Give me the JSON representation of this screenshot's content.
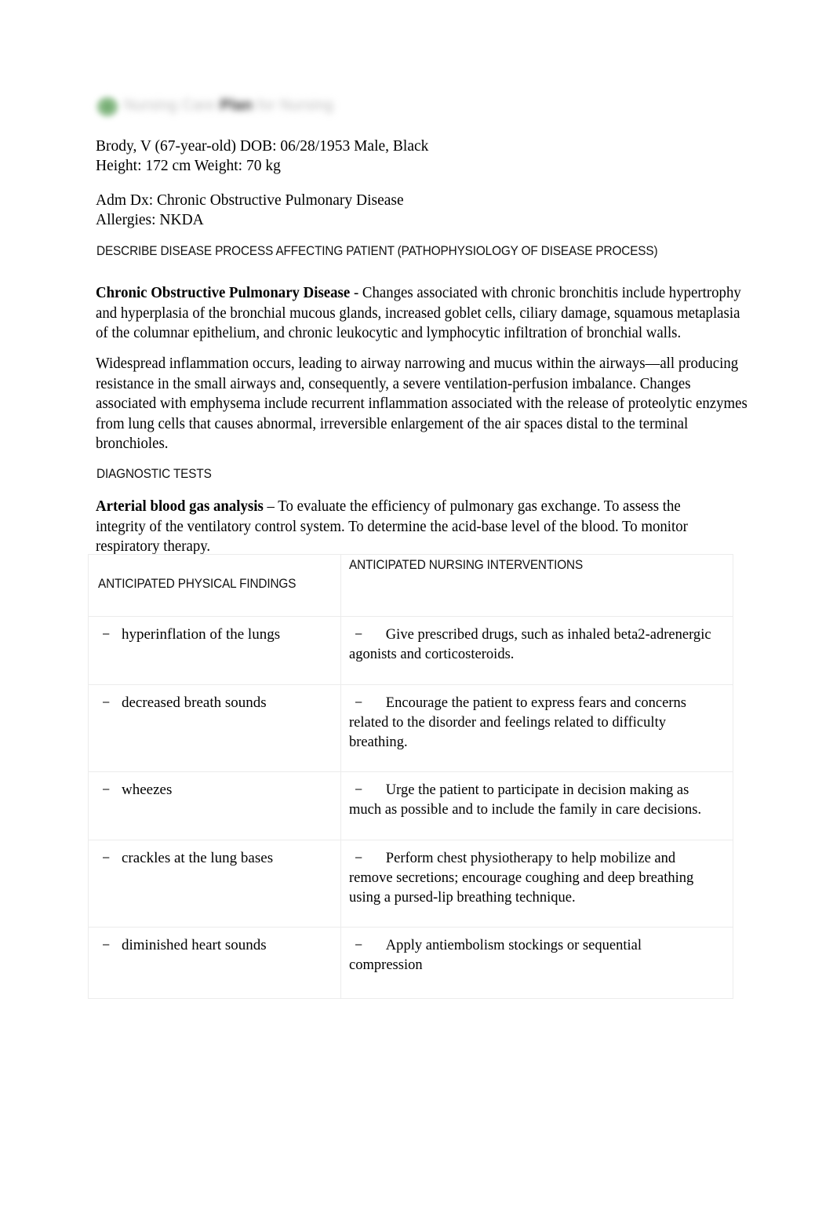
{
  "document": {
    "logo": {
      "mark": "green-circle-logo-mark",
      "text_light": "Nursing Care ",
      "text_dark": "Plan",
      "text_tail": " for Nursing"
    },
    "patient": {
      "line1": "Brody, V (67-year-old) DOB: 06/28/1953 Male, Black",
      "line2": "Height: 172 cm Weight: 70 kg",
      "block": "Brody, V (67-year-old) DOB: 06/28/1953 Male, Black\nHeight: 172 cm Weight: 70 kg"
    },
    "admission": {
      "dx": "Adm Dx: Chronic Obstructive Pulmonary Disease",
      "allergies": "Allergies: NKDA",
      "block": "Adm Dx: Chronic Obstructive Pulmonary Disease\nAllergies: NKDA"
    },
    "sections": {
      "pathophysiology_heading": "DESCRIBE DISEASE PROCESS AFFECTING PATIENT (PATHOPHYSIOLOGY OF DISEASE PROCESS)",
      "diagnostic_tests_heading": "DIAGNOSTIC TESTS"
    },
    "pathophysiology": {
      "term": "Chronic Obstructive Pulmonary Disease",
      "dash": "-",
      "paragraph1": "Changes associated with chronic bronchitis include hypertrophy and hyperplasia of the bronchial mucous glands, increased goblet cells, ciliary damage, squamous metaplasia of the columnar epithelium, and chronic leukocytic and lymphocytic infiltration of bronchial walls.",
      "paragraph2": "Widespread inflammation occurs, leading to airway narrowing and mucus within the airways—all producing resistance in the small airways and, consequently, a severe ventilation-perfusion imbalance. Changes associated with emphysema include recurrent inflammation associated with the release of proteolytic enzymes from lung cells that causes abnormal, irreversible enlargement of the air spaces distal to the terminal bronchioles."
    },
    "diagnostic_test": {
      "name": "Arterial blood gas analysis",
      "dash": "–",
      "description": "To evaluate the efficiency of pulmonary gas exchange. To assess the integrity of the ventilatory control system. To determine the acid-base level of the blood. To monitor respiratory therapy."
    },
    "table": {
      "headers": {
        "findings": "ANTICIPATED PHYSICAL FINDINGS",
        "interventions": "ANTICIPATED NURSING INTERVENTIONS"
      },
      "bullet_glyph": "–",
      "rows": [
        {
          "finding": "hyperinflation of the lungs",
          "intervention": "Give prescribed drugs, such as inhaled beta2-adrenergic agonists and corticosteroids."
        },
        {
          "finding": "decreased breath sounds",
          "intervention": "Encourage the patient to express fears and concerns related to the disorder and feelings related to difficulty breathing."
        },
        {
          "finding": "wheezes",
          "intervention": "Urge the patient to participate in decision making as much as possible and to include the family in care decisions."
        },
        {
          "finding": "crackles at the lung bases",
          "intervention": "Perform chest physiotherapy to help mobilize and remove secretions; encourage coughing and deep breathing using a pursed-lip breathing technique."
        },
        {
          "finding": "diminished heart sounds",
          "intervention": "Apply antiembolism stockings or sequential compression"
        }
      ]
    },
    "colors": {
      "logo_green": "#6aa568",
      "table_border": "#ececec",
      "text": "#000000"
    }
  }
}
